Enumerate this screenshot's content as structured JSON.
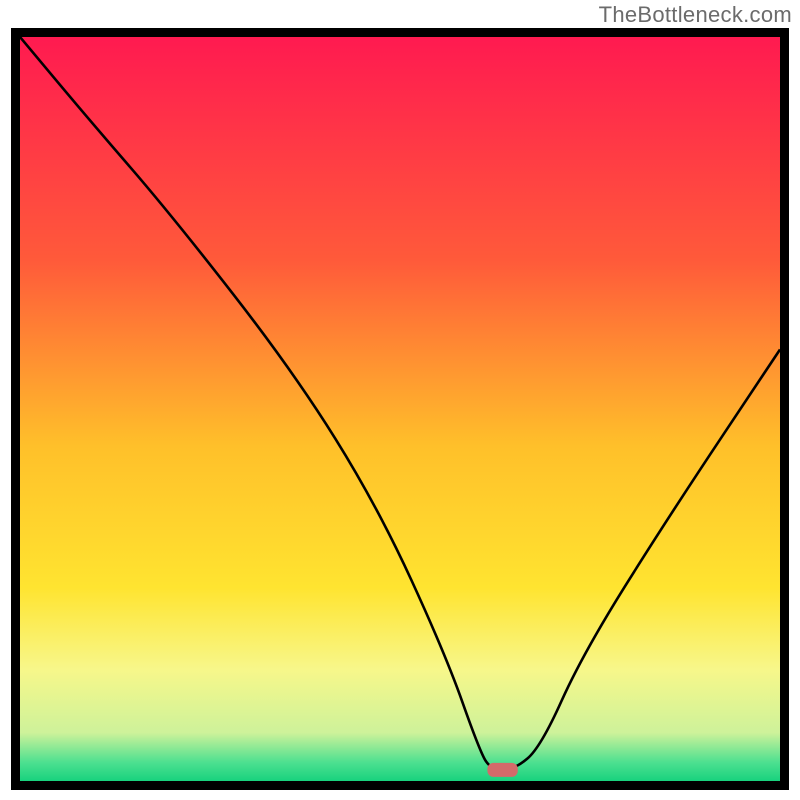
{
  "watermark": "TheBottleneck.com",
  "chart_data": {
    "type": "line",
    "title": "",
    "xlabel": "",
    "ylabel": "",
    "xlim": [
      0,
      100
    ],
    "ylim": [
      0,
      100
    ],
    "grid": false,
    "legend": false,
    "annotations": [],
    "background_gradient_stops": [
      {
        "offset": 0.0,
        "color": "#ff1a50"
      },
      {
        "offset": 0.3,
        "color": "#ff5a3a"
      },
      {
        "offset": 0.55,
        "color": "#ffc02a"
      },
      {
        "offset": 0.74,
        "color": "#ffe430"
      },
      {
        "offset": 0.85,
        "color": "#f7f78a"
      },
      {
        "offset": 0.935,
        "color": "#cef29a"
      },
      {
        "offset": 0.975,
        "color": "#4de090"
      },
      {
        "offset": 1.0,
        "color": "#18d27e"
      }
    ],
    "series": [
      {
        "name": "bottleneck-curve",
        "color": "#000000",
        "x": [
          0.0,
          9.0,
          20.0,
          36.0,
          47.0,
          56.0,
          60.5,
          62.0,
          65.0,
          68.5,
          74.0,
          85.0,
          100.0
        ],
        "y": [
          100.0,
          89.0,
          76.0,
          55.0,
          37.0,
          17.0,
          4.0,
          1.5,
          1.5,
          4.5,
          17.0,
          35.0,
          58.0
        ]
      }
    ],
    "marker": {
      "name": "optimal-point",
      "x_center": 63.5,
      "width": 4.0,
      "y": 1.5,
      "color": "#d46a6a"
    },
    "frame_color": "#000000",
    "frame_thickness_px": 9
  }
}
